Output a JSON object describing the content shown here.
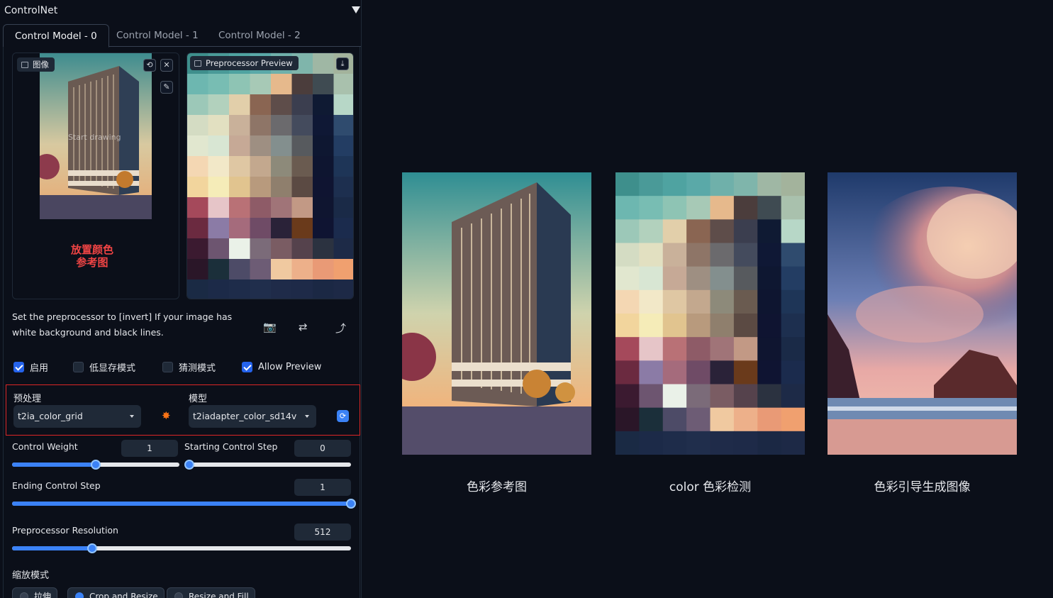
{
  "panel": {
    "title": "ControlNet",
    "tabs": [
      {
        "label": "Control Model - 0",
        "active": true
      },
      {
        "label": "Control Model - 1",
        "active": false
      },
      {
        "label": "Control Model - 2",
        "active": false
      }
    ]
  },
  "image_input": {
    "label": "图像",
    "overlay_text": "Start drawing",
    "annotation": "放置颜色\n参考图"
  },
  "preprocessor_preview": {
    "label": "Preprocessor Preview"
  },
  "hint": "Set the preprocessor to [invert] If your image has white background and black lines.",
  "checkboxes": [
    {
      "label": "启用",
      "checked": true
    },
    {
      "label": "低显存模式",
      "checked": false
    },
    {
      "label": "猜测模式",
      "checked": false
    },
    {
      "label": "Allow Preview",
      "checked": true
    }
  ],
  "preprocessor": {
    "label": "预处理",
    "value": "t2ia_color_grid"
  },
  "model": {
    "label": "模型",
    "value": "t2iadapter_color_sd14v"
  },
  "sliders": {
    "control_weight": {
      "label": "Control Weight",
      "value": "1",
      "fraction": 0.5
    },
    "starting_step": {
      "label": "Starting Control Step",
      "value": "0",
      "fraction": 0.0
    },
    "ending_step": {
      "label": "Ending Control Step",
      "value": "1",
      "fraction": 1.0
    },
    "preprocessor_resolution": {
      "label": "Preprocessor Resolution",
      "value": "512",
      "fraction": 0.236
    }
  },
  "resize_mode": {
    "label": "缩放模式",
    "options": [
      {
        "label": "拉伸",
        "selected": false
      },
      {
        "label": "Crop and Resize",
        "selected": true
      },
      {
        "label": "Resize and Fill",
        "selected": false
      }
    ]
  },
  "showcase": {
    "captions": [
      "色彩参考图",
      "color 色彩检测",
      "色彩引导生成图像"
    ]
  },
  "color_grid": [
    [
      "#3e8f8c",
      "#4a9a98",
      "#4fa3a1",
      "#5aa9a8",
      "#6fb0aa",
      "#7fb5ab",
      "#9fb7a4",
      "#a3b39c"
    ],
    [
      "#6db7b0",
      "#78bdb3",
      "#8ec4b4",
      "#a7c9b6",
      "#e6b98c",
      "#4b3d3c",
      "#3f4b52",
      "#a9c1ad"
    ],
    [
      "#9cc8b8",
      "#b2d1bd",
      "#e2cfaa",
      "#8a6552",
      "#5e4d4a",
      "#3b3e4f",
      "#0f1a33",
      "#b7d7c7"
    ],
    [
      "#d4dcc3",
      "#e2e0c1",
      "#c9b19a",
      "#8e7567",
      "#6b6a6d",
      "#444b5d",
      "#0f1835",
      "#2f4b6e"
    ],
    [
      "#e1e7cf",
      "#d8e6d3",
      "#c6a996",
      "#9e8f82",
      "#838f8e",
      "#575a5e",
      "#0e1731",
      "#233d63"
    ],
    [
      "#f4d7b3",
      "#f2e8c8",
      "#dfc7a3",
      "#c3a88e",
      "#8d8a7a",
      "#6a5b50",
      "#0e1530",
      "#1e3557"
    ],
    [
      "#f2d59d",
      "#f5ecb8",
      "#e1c48f",
      "#b89a7d",
      "#8f7f6d",
      "#5b4a43",
      "#0f1431",
      "#1d2f4f"
    ],
    [
      "#a5495b",
      "#e6c5c8",
      "#b97176",
      "#8e5b67",
      "#a07478",
      "#c29985",
      "#0f1530",
      "#1a2a47"
    ],
    [
      "#6b2a40",
      "#8b7ba6",
      "#a56b7c",
      "#6f4b66",
      "#2a2238",
      "#6a3a1b",
      "#0f1432",
      "#1b2b4d"
    ],
    [
      "#3b1a30",
      "#6d5570",
      "#eaf1e8",
      "#7b6b79",
      "#7a5c63",
      "#55424c",
      "#2b3240",
      "#1d2a47"
    ],
    [
      "#2a1628",
      "#1b2f3a",
      "#4d4b67",
      "#6d5c75",
      "#f0c9a0",
      "#edb08a",
      "#e99a76",
      "#f0a06f"
    ],
    [
      "#1a2a44",
      "#1c2a48",
      "#1e2c4a",
      "#202e4c",
      "#1f2b49",
      "#1e2a48",
      "#1b2844",
      "#1d2946"
    ]
  ]
}
